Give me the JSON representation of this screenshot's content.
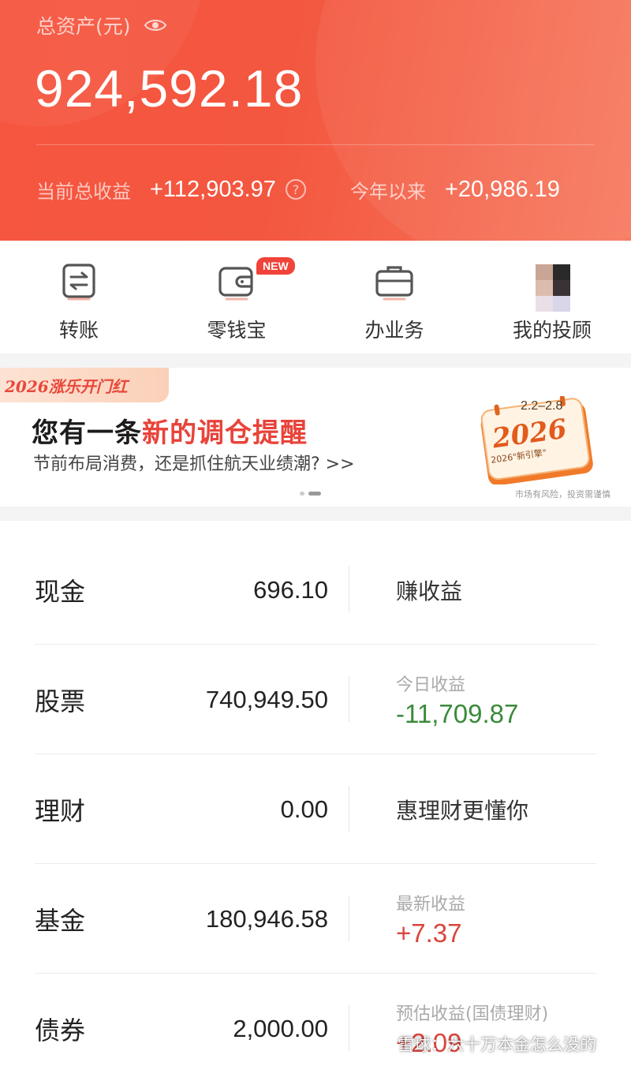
{
  "header": {
    "total_label": "总资产(元)",
    "total_value": "924,592.18",
    "profit_label": "当前总收益",
    "profit_value": "+112,903.97",
    "ytd_label": "今年以来",
    "ytd_value": "+20,986.19",
    "icons": [
      "eye-icon",
      "question-icon"
    ]
  },
  "actions": [
    {
      "label": "转账",
      "icon": "transfer-icon"
    },
    {
      "label": "零钱宝",
      "icon": "wallet-icon",
      "badge": "NEW"
    },
    {
      "label": "办业务",
      "icon": "briefcase-icon"
    },
    {
      "label": "我的投顾",
      "icon": "advisor-avatar"
    }
  ],
  "banner": {
    "tag": "2026涨乐开门红",
    "title_prefix": "您有一条",
    "title_highlight": "新的调仓提醒",
    "subtitle": "节前布局消费，还是抓住航天业绩潮? >>",
    "cal_dates": "2.2–2.8",
    "cal_year": "2026",
    "cal_sub": "2026\"新引擎\"",
    "disclaimer": "市场有风险，投资需谨慎"
  },
  "assets": [
    {
      "name": "现金",
      "amount": "696.10",
      "right_text": "赚收益"
    },
    {
      "name": "股票",
      "amount": "740,949.50",
      "right_label": "今日收益",
      "right_value": "-11,709.87",
      "right_color": "#3a8a3a"
    },
    {
      "name": "理财",
      "amount": "0.00",
      "right_text": "惠理财更懂你"
    },
    {
      "name": "基金",
      "amount": "180,946.58",
      "right_label": "最新收益",
      "right_value": "+7.37",
      "right_color": "#d9453c"
    },
    {
      "name": "债券",
      "amount": "2,000.00",
      "right_label": "预估收益(国债理财)",
      "right_value": "+2.09",
      "right_color": "#d9453c"
    }
  ],
  "watermark": "雪球：六十万本金怎么没的",
  "colors": {
    "header_red": "#f6553f",
    "accent_red": "#e8433a",
    "gain_red": "#d9453c",
    "loss_green": "#3a8a3a"
  }
}
